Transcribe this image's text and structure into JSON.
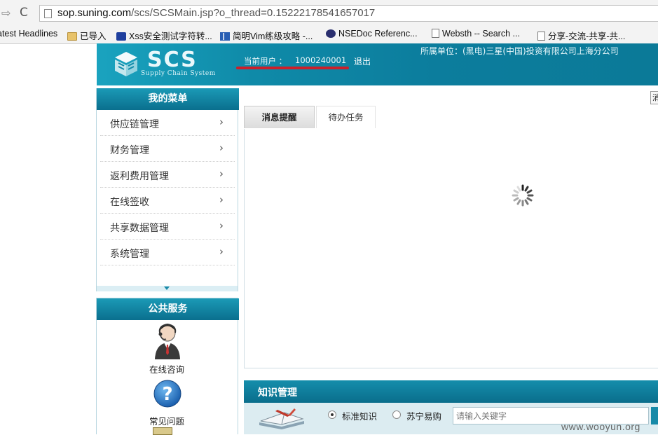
{
  "browser": {
    "url_host": "sop.suning.com",
    "url_path": "/scs/SCSMain.jsp?o_thread=0.15222178541657017",
    "bookmarks": [
      {
        "label": "atest Headlines",
        "icon": "none"
      },
      {
        "label": "已导入",
        "icon": "folder-icon"
      },
      {
        "label": "Xss安全测试字符转...",
        "icon": "paw-icon"
      },
      {
        "label": "简明Vim练级攻略 -...",
        "icon": "grid-icon"
      },
      {
        "label": "NSEDoc Referenc...",
        "icon": "eye-icon"
      },
      {
        "label": "Websth -- Search ...",
        "icon": "page-icon"
      },
      {
        "label": "分享-交流-共享-共...",
        "icon": "page-icon"
      }
    ]
  },
  "header": {
    "logo_text": "SCS",
    "logo_subtitle": "Supply Chain System",
    "user_label": "当前用户 ：",
    "user_id": "1000240001",
    "logout_label": "退出",
    "company": "所属单位：(黑电)三星(中国)投资有限公司上海分公司",
    "accent": "#0c7d9d",
    "underline_color": "#cc1f2a"
  },
  "menu": {
    "title": "我的菜单",
    "items": [
      {
        "label": "供应链管理"
      },
      {
        "label": "财务管理"
      },
      {
        "label": "返利费用管理"
      },
      {
        "label": "在线签收"
      },
      {
        "label": "共享数据管理"
      },
      {
        "label": "系统管理"
      }
    ]
  },
  "services": {
    "title": "公共服务",
    "items": [
      {
        "label": "在线咨询",
        "icon": "support-agent-icon"
      },
      {
        "label": "常见问题",
        "icon": "question-icon"
      }
    ]
  },
  "tabs": [
    {
      "label": "消息提醒",
      "active": true
    },
    {
      "label": "待办任务",
      "active": false
    }
  ],
  "corner_button_label": "消",
  "knowledge": {
    "title": "知识管理",
    "options": [
      {
        "label": "标准知识",
        "selected": true
      },
      {
        "label": "苏宁易购",
        "selected": false
      }
    ],
    "search_placeholder": "请输入关键字"
  },
  "watermark": "www.wooyun.org"
}
